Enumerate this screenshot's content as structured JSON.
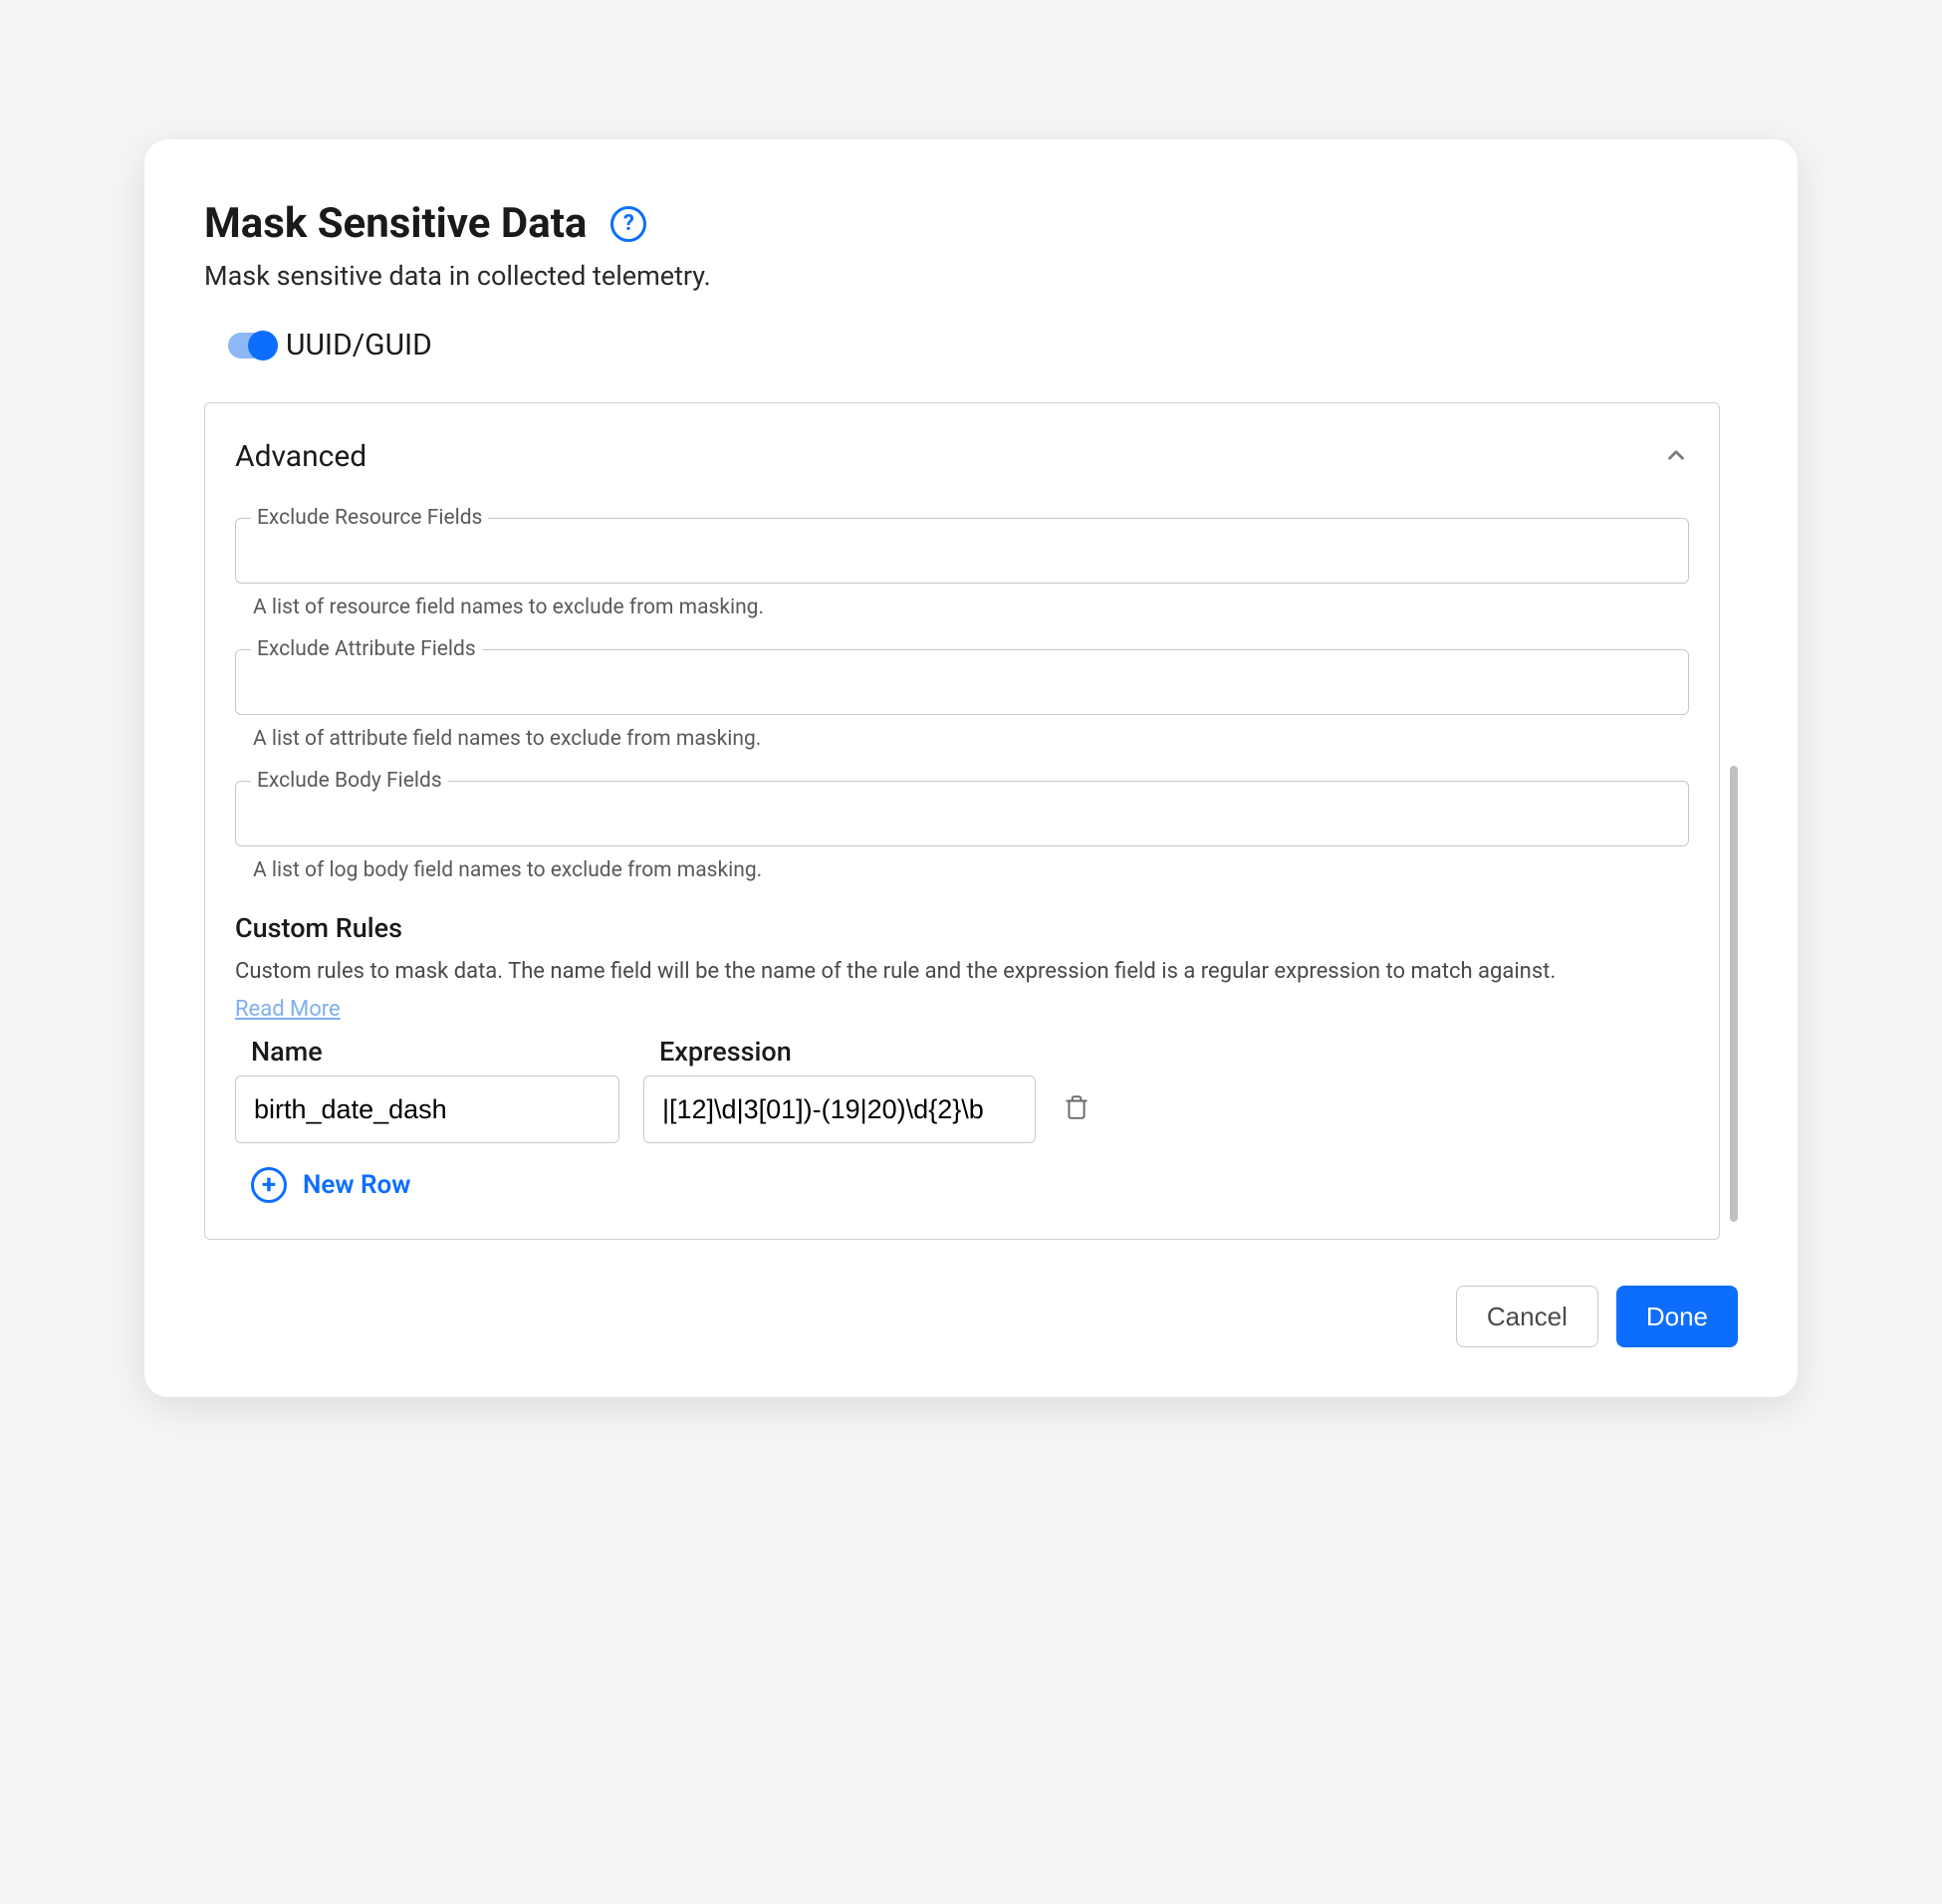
{
  "header": {
    "title": "Mask Sensitive Data",
    "subtitle": "Mask sensitive data in collected telemetry."
  },
  "toggle": {
    "label": "UUID/GUID",
    "enabled": true
  },
  "advanced": {
    "title": "Advanced",
    "fields": {
      "exclude_resource": {
        "label": "Exclude Resource Fields",
        "value": "",
        "help": "A list of resource field names to exclude from masking."
      },
      "exclude_attribute": {
        "label": "Exclude Attribute Fields",
        "value": "",
        "help": "A list of attribute field names to exclude from masking."
      },
      "exclude_body": {
        "label": "Exclude Body Fields",
        "value": "",
        "help": "A list of log body field names to exclude from masking."
      }
    },
    "custom_rules": {
      "title": "Custom Rules",
      "description": "Custom rules to mask data. The name field will be the name of the rule and the expression field is a regular expression to match against.",
      "read_more": "Read More",
      "columns": {
        "name": "Name",
        "expression": "Expression"
      },
      "rows": [
        {
          "name": "birth_date_dash",
          "expression": "|[12]\\d|3[01])-(19|20)\\d{2}\\b"
        }
      ],
      "new_row_label": "New Row"
    }
  },
  "footer": {
    "cancel": "Cancel",
    "done": "Done"
  }
}
